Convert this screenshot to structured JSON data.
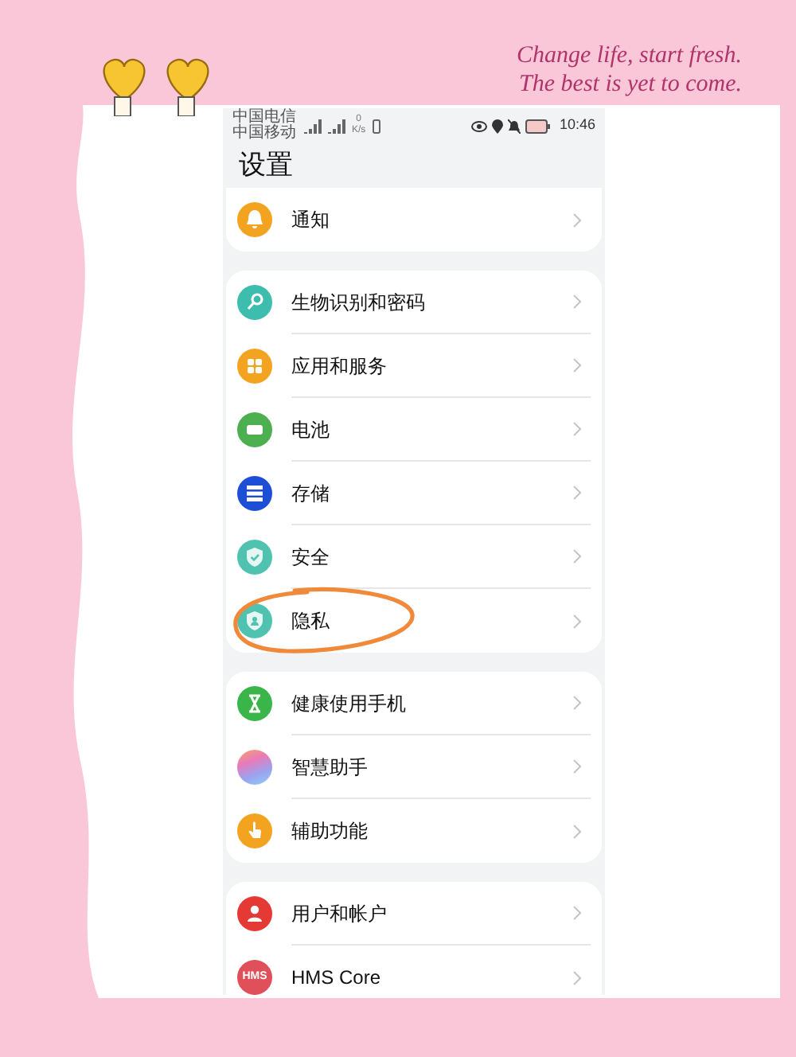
{
  "banner": [
    "Change life, start fresh.",
    "The best is yet to come."
  ],
  "status_bar": {
    "carriers": [
      "中国电信",
      "中国移动"
    ],
    "speed": [
      "0",
      "K/s"
    ],
    "time": "10:46"
  },
  "title": "设置",
  "groups": [
    {
      "partial": true,
      "items": [
        {
          "label": "通知",
          "kind": "bell",
          "color": "#f4a321",
          "circled": false
        }
      ]
    },
    {
      "partial": false,
      "items": [
        {
          "label": "生物识别和密码",
          "kind": "key",
          "color": "#3dbdad",
          "circled": false
        },
        {
          "label": "应用和服务",
          "kind": "apps",
          "color": "#f4a321",
          "circled": false
        },
        {
          "label": "电池",
          "kind": "battery",
          "color": "#4caf50",
          "circled": false
        },
        {
          "label": "存储",
          "kind": "storage",
          "color": "#1d4fd6",
          "circled": false
        },
        {
          "label": "安全",
          "kind": "shield",
          "color": "#4fc3b0",
          "circled": false
        },
        {
          "label": "隐私",
          "kind": "privacy",
          "color": "#4fc3b0",
          "circled": true
        }
      ]
    },
    {
      "partial": false,
      "items": [
        {
          "label": "健康使用手机",
          "kind": "hourglass",
          "color": "#39b54a",
          "circled": false
        },
        {
          "label": "智慧助手",
          "kind": "gradient",
          "circled": false
        },
        {
          "label": "辅助功能",
          "kind": "hand",
          "color": "#f4a321",
          "circled": false
        }
      ]
    },
    {
      "partial": false,
      "items": [
        {
          "label": "用户和帐户",
          "kind": "user",
          "color": "#e53935",
          "circled": false
        },
        {
          "label": "HMS Core",
          "kind": "text",
          "icon_text": "HMS",
          "color": "#e0505a",
          "circled": false
        }
      ]
    }
  ]
}
